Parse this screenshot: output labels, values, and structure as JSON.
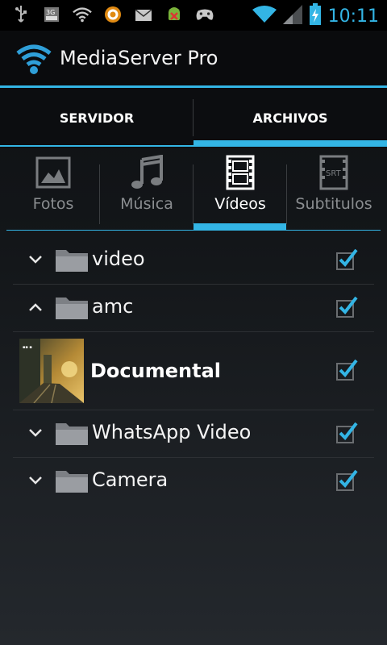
{
  "status_bar": {
    "time": "10:11",
    "left_icons": [
      "usb-icon",
      "3g-icon",
      "wifi-icon",
      "orange-app-icon",
      "mail-icon",
      "android-warning-icon",
      "gamepad-icon"
    ],
    "right_icons": [
      "wifi-signal-icon",
      "cell-signal-icon",
      "battery-charging-icon"
    ],
    "accent": "#33b5e5"
  },
  "app": {
    "title": "MediaServer Pro",
    "icon": "wifi-logo-icon"
  },
  "main_tabs": [
    {
      "label": "SERVIDOR",
      "selected": false
    },
    {
      "label": "ARCHIVOS",
      "selected": true
    }
  ],
  "category_tabs": [
    {
      "label": "Fotos",
      "icon": "photo-icon",
      "selected": false
    },
    {
      "label": "Música",
      "icon": "music-note-icon",
      "selected": false
    },
    {
      "label": "Vídeos",
      "icon": "film-strip-icon",
      "selected": true
    },
    {
      "label": "Subtitulos",
      "icon": "srt-icon",
      "selected": false
    }
  ],
  "items": [
    {
      "type": "folder",
      "name": "video",
      "expanded": false,
      "checked": true
    },
    {
      "type": "folder",
      "name": "amc",
      "expanded": true,
      "checked": true
    },
    {
      "type": "file",
      "name": "Documental",
      "checked": true
    },
    {
      "type": "folder",
      "name": "WhatsApp Video",
      "expanded": false,
      "checked": true
    },
    {
      "type": "folder",
      "name": "Camera",
      "expanded": false,
      "checked": true
    }
  ]
}
